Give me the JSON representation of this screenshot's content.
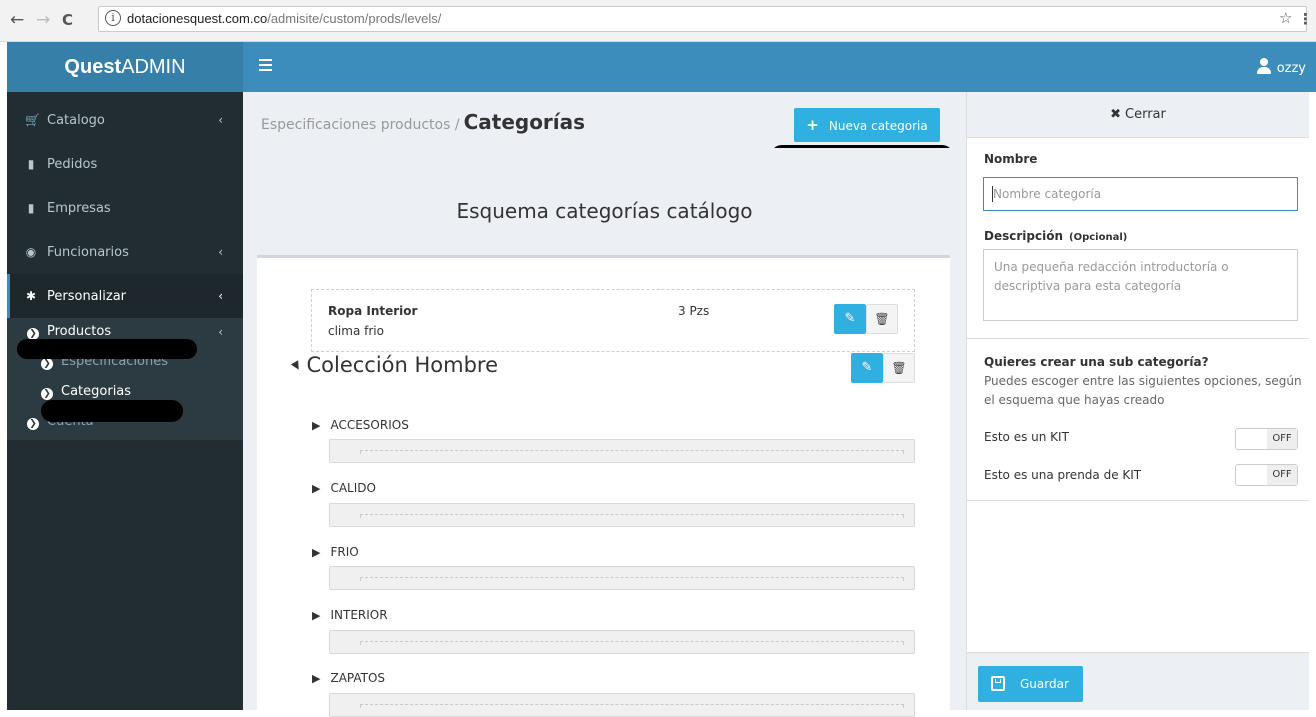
{
  "browser": {
    "back": "←",
    "forward": "→",
    "reload": "C",
    "url_host": "dotacionesquest.com.co",
    "url_path": "/admisite/custom/prods/levels/",
    "star": "☆",
    "menu": "⋮"
  },
  "brand": {
    "bold": "Quest",
    "regular": "ADMIN"
  },
  "user": {
    "name": "ozzy"
  },
  "sidebar": {
    "items": [
      {
        "label": "Catalogo",
        "icon": "cart-icon",
        "glyph": "🛒",
        "chevron": "‹"
      },
      {
        "label": "Pedidos",
        "icon": "file-icon",
        "glyph": "▇"
      },
      {
        "label": "Empresas",
        "icon": "file-icon",
        "glyph": "▇"
      },
      {
        "label": "Funcionarios",
        "icon": "user-circle-icon",
        "glyph": "●",
        "chevron": "‹"
      },
      {
        "label": "Personalizar",
        "icon": "gear-icon",
        "glyph": "✱",
        "chevron": "‹"
      }
    ],
    "sub": [
      {
        "label": "Productos",
        "chevron": "‹"
      },
      {
        "label": "Especificaciones"
      },
      {
        "label": "Categorias"
      },
      {
        "label": "Cuenta"
      }
    ]
  },
  "header": {
    "breadcrumb_parent": "Especificaciones productos /",
    "breadcrumb_current": "Categorías",
    "new_button": "Nueva categoria"
  },
  "main": {
    "title": "Esquema categorías catálogo",
    "item": {
      "name": "Ropa Interior",
      "description": "clima frio",
      "quantity": "3 Pzs"
    },
    "collection": "Colección Hombre",
    "subcategories": [
      "ACCESORIOS",
      "CALIDO",
      "FRIO",
      "INTERIOR",
      "ZAPATOS"
    ]
  },
  "panel": {
    "close": "Cerrar",
    "name_label": "Nombre",
    "name_placeholder": "Nombre categoría",
    "desc_label": "Descripción",
    "desc_optional": "(Opcional)",
    "desc_placeholder": "Una pequeña redacción introductoría o descriptiva para esta categoría",
    "sub_question": "Quieres crear una sub categoría?",
    "sub_help": "Puedes escoger entre las siguientes opciones, según el esquema que hayas creado",
    "kit_label": "Esto es un KIT",
    "kit_state": "OFF",
    "kit_item_label": "Esto es una prenda de KIT",
    "kit_item_state": "OFF",
    "save": "Guardar"
  },
  "colors": {
    "navbar": "#3c8dbc",
    "brand": "#367fa9",
    "sidebar": "#222d32",
    "button": "#2fb0e0"
  }
}
